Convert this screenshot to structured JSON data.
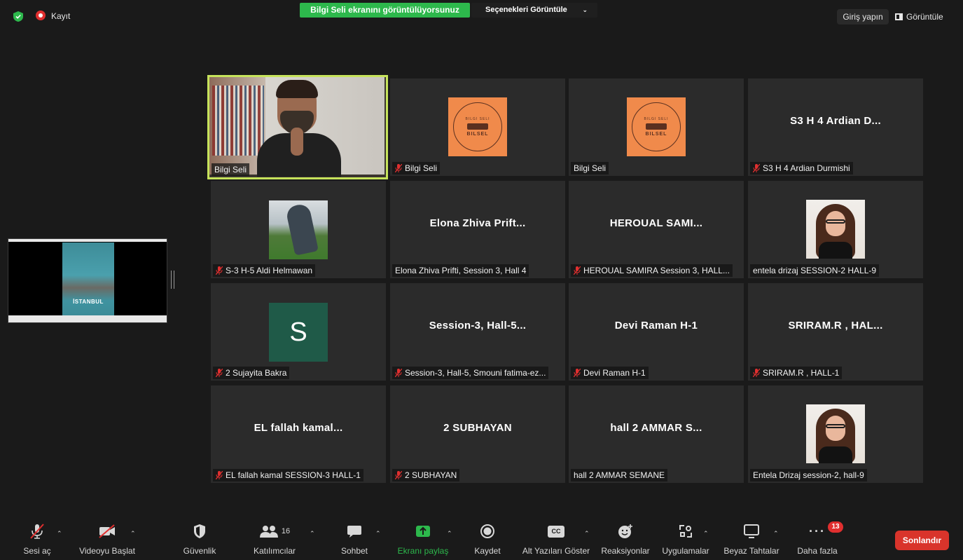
{
  "topbar": {
    "recording_label": "Kayıt",
    "share_banner": "Bilgi Seli ekranını görüntülüyorsunuz",
    "view_options": "Seçenekleri Görüntüle",
    "signin": "Giriş yapın",
    "view": "Görüntüle"
  },
  "shared_screen": {
    "poster_title": "İSTANBUL"
  },
  "tiles": [
    {
      "name": "Bilgi Seli",
      "big": "",
      "muted": false
    },
    {
      "name": "Bilgi Seli",
      "big": "",
      "muted": true
    },
    {
      "name": "Bilgi Seli",
      "big": "",
      "muted": false
    },
    {
      "name": "S3 H 4  Ardian Durmishi",
      "big": "S3 H 4  Ardian D...",
      "muted": true
    },
    {
      "name": "S-3 H-5 Aldi Helmawan",
      "big": "",
      "muted": true
    },
    {
      "name": "Elona Zhiva Prifti, Session 3, Hall 4",
      "big": "Elona Zhiva Prift...",
      "muted": false
    },
    {
      "name": "HEROUAL SAMIRA  Session 3, HALL...",
      "big": "HEROUAL  SAMI...",
      "muted": true
    },
    {
      "name": "entela drizaj SESSION-2  HALL-9",
      "big": "",
      "muted": false
    },
    {
      "name": "2 Sujayita Bakra",
      "big": "",
      "avatar_letter": "S",
      "muted": true
    },
    {
      "name": "Session-3, Hall-5, Smouni fatima-ez...",
      "big": "Session-3,  Hall-5...",
      "muted": true
    },
    {
      "name": "Devi Raman H-1",
      "big": "Devi Raman H-1",
      "muted": true
    },
    {
      "name": "SRIRAM.R , HALL-1",
      "big": "SRIRAM.R , HAL...",
      "muted": true
    },
    {
      "name": "EL fallah kamal  SESSION-3  HALL-1",
      "big": "EL fallah kamal...",
      "muted": true
    },
    {
      "name": "2 SUBHAYAN",
      "big": "2 SUBHAYAN",
      "muted": true
    },
    {
      "name": "hall 2 AMMAR SEMANE",
      "big": "hall 2 AMMAR S...",
      "muted": false
    },
    {
      "name": "Entela Drizaj session-2, hall-9",
      "big": "",
      "muted": false
    }
  ],
  "logo": {
    "line1": "BILGI SELI",
    "line2": "BILSEL"
  },
  "toolbar": {
    "unmute": "Sesi aç",
    "start_video": "Videoyu Başlat",
    "security": "Güvenlik",
    "participants": "Katılımcılar",
    "participant_count": "16",
    "chat": "Sohbet",
    "share_screen": "Ekranı paylaş",
    "record": "Kaydet",
    "captions": "Alt Yazıları Göster",
    "captions_icon_text": "CC",
    "reactions": "Reaksiyonlar",
    "apps": "Uygulamalar",
    "whiteboards": "Beyaz Tahtalar",
    "more": "Daha fazla",
    "more_badge": "13",
    "end": "Sonlandır"
  },
  "colors": {
    "share_green": "#2db84c",
    "speaker_border": "#c6e35b",
    "end_red": "#d9342b",
    "mute_red": "#e02f2f"
  }
}
